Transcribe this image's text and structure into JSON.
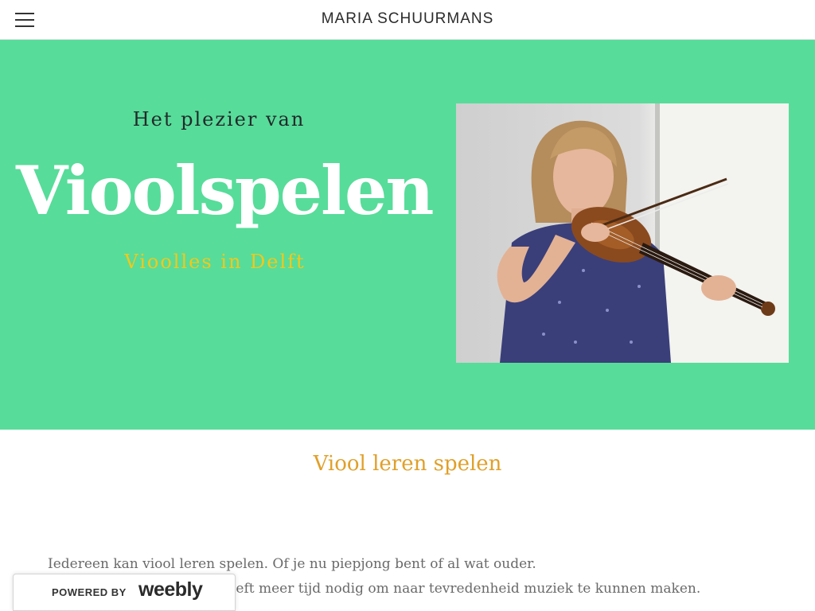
{
  "header": {
    "site_title": "MARIA SCHUURMANS",
    "menu_icon": "hamburger-menu-icon"
  },
  "hero": {
    "pretitle": "Het plezier van",
    "title": "Vioolspelen",
    "subtitle": "Vioolles in Delft",
    "background": "#57dc9a",
    "title_color": "#ffffff",
    "subtitle_color": "#f2c81a"
  },
  "content": {
    "heading": "Viool leren spelen",
    "heading_color": "#e0a02a",
    "paragraph1": "Iedereen kan viool leren spelen. Of je nu piepjong bent of al wat ouder.",
    "paragraph2": "Een volwassen beginner heeft meer tijd nodig om naar tevredenheid muziek te kunnen maken."
  },
  "badge": {
    "powered": "POWERED BY",
    "brand": "weebly"
  }
}
